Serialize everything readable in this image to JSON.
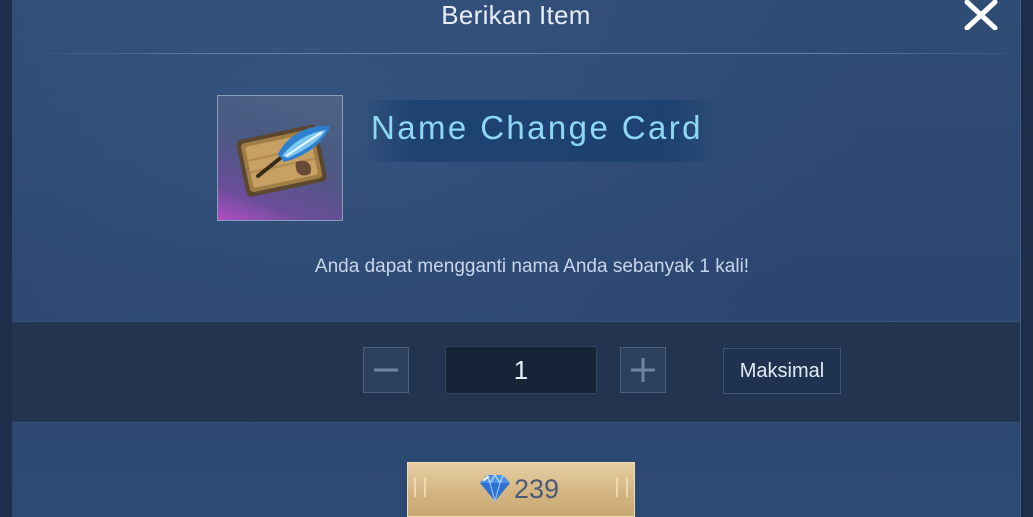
{
  "dialog": {
    "title": "Berikan Item",
    "close_icon": "close-x-icon"
  },
  "item": {
    "name": "Name Change Card",
    "icon": "quill-card-icon",
    "description": "Anda dapat mengganti nama Anda sebanyak 1 kali!"
  },
  "quantity": {
    "value": "1",
    "minus_icon": "minus-icon",
    "plus_icon": "plus-icon",
    "max_label": "Maksimal"
  },
  "purchase": {
    "price": "239",
    "currency_icon": "diamond-icon"
  },
  "colors": {
    "item_name": "#8fd8f4",
    "buy_button": "#d4b581",
    "panel": "#2b4670"
  }
}
